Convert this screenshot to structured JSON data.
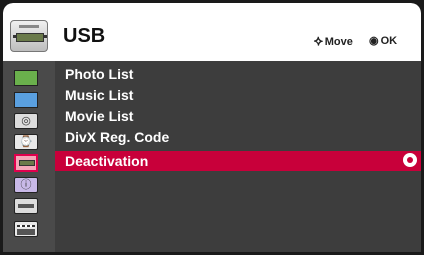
{
  "header": {
    "title": "USB",
    "icon": "usb-plug-icon",
    "move_hint": "Move",
    "ok_hint": "OK",
    "move_glyph": "⯎",
    "ok_glyph": "◉"
  },
  "sidebar": {
    "items": [
      {
        "icon": "picture-icon"
      },
      {
        "icon": "sound-icon"
      },
      {
        "icon": "settings-icon"
      },
      {
        "icon": "clock-icon"
      },
      {
        "icon": "usb-icon",
        "selected": true
      },
      {
        "icon": "info-icon"
      },
      {
        "icon": "input-icon"
      },
      {
        "icon": "clapper-icon"
      }
    ],
    "glyphs": {
      "settings": "◎",
      "clock": "⌚",
      "info": "ⓘ"
    }
  },
  "menu": {
    "items": [
      {
        "label": "Photo List"
      },
      {
        "label": "Music List"
      },
      {
        "label": "Movie List"
      },
      {
        "label": "DivX Reg. Code"
      },
      {
        "label": "Deactivation",
        "selected": true
      }
    ]
  },
  "colors": {
    "selection": "#c8003a",
    "panel": "#3d3d3d",
    "header": "#ffffff"
  }
}
